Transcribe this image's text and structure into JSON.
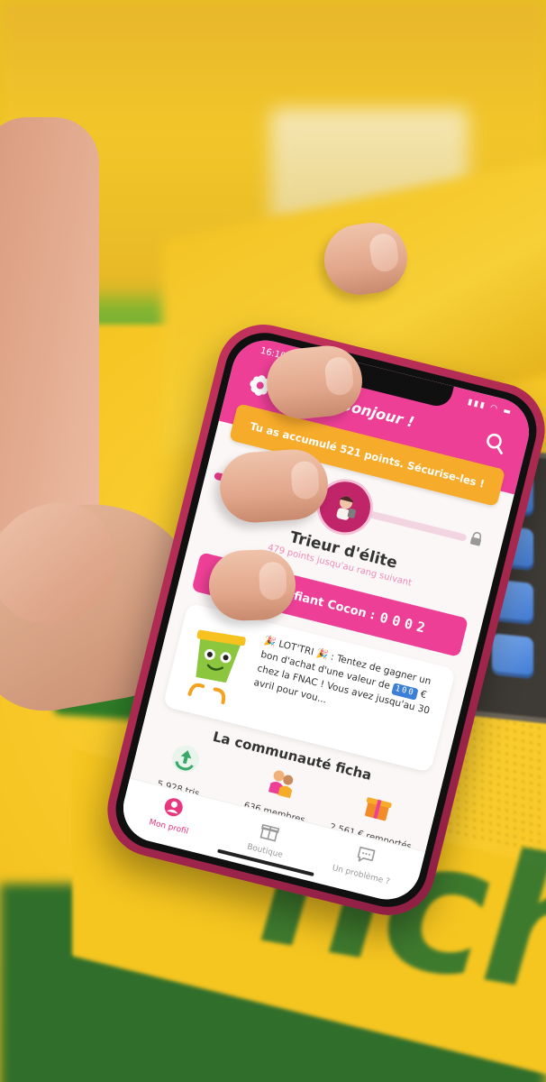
{
  "app": {
    "status_time": "16:10",
    "greeting": "Bonjour !",
    "banner": "Tu as accumulé 521 points. Sécurise-les !",
    "progress": 0.55,
    "rank_title": "Trieur d'élite",
    "rank_subtitle": "479 points jusqu'au rang suivant",
    "identifier_label": "Ton identifiant Cocon :",
    "identifier_value": "0002",
    "promo": {
      "prefix": "🎉 LOT'TRI 🎉 : Tentez de gagner un bon d'achat d'une valeur de",
      "amount": "100",
      "suffix": "€ chez la FNAC ! Vous avez jusqu'au 30 avril pour vou..."
    },
    "community_title": "La communauté ficha",
    "stats": [
      {
        "value": "5 928 tris",
        "icon": "recycle-icon"
      },
      {
        "value": "636 membres",
        "icon": "people-icon"
      },
      {
        "value": "2 561 € remportés",
        "icon": "gift-icon"
      }
    ],
    "nav": [
      {
        "label": "Mon profil",
        "icon": "profile-icon",
        "active": true
      },
      {
        "label": "Boutique",
        "icon": "gift-box-icon",
        "active": false
      },
      {
        "label": "Un problème ?",
        "icon": "chat-icon",
        "active": false
      }
    ]
  },
  "brand_word": "ficha",
  "colors": {
    "header_pink": "#ee3f97",
    "banner_orange": "#f7ab2a",
    "machine_yellow": "#f5c523",
    "brand_green": "#2f7430"
  }
}
